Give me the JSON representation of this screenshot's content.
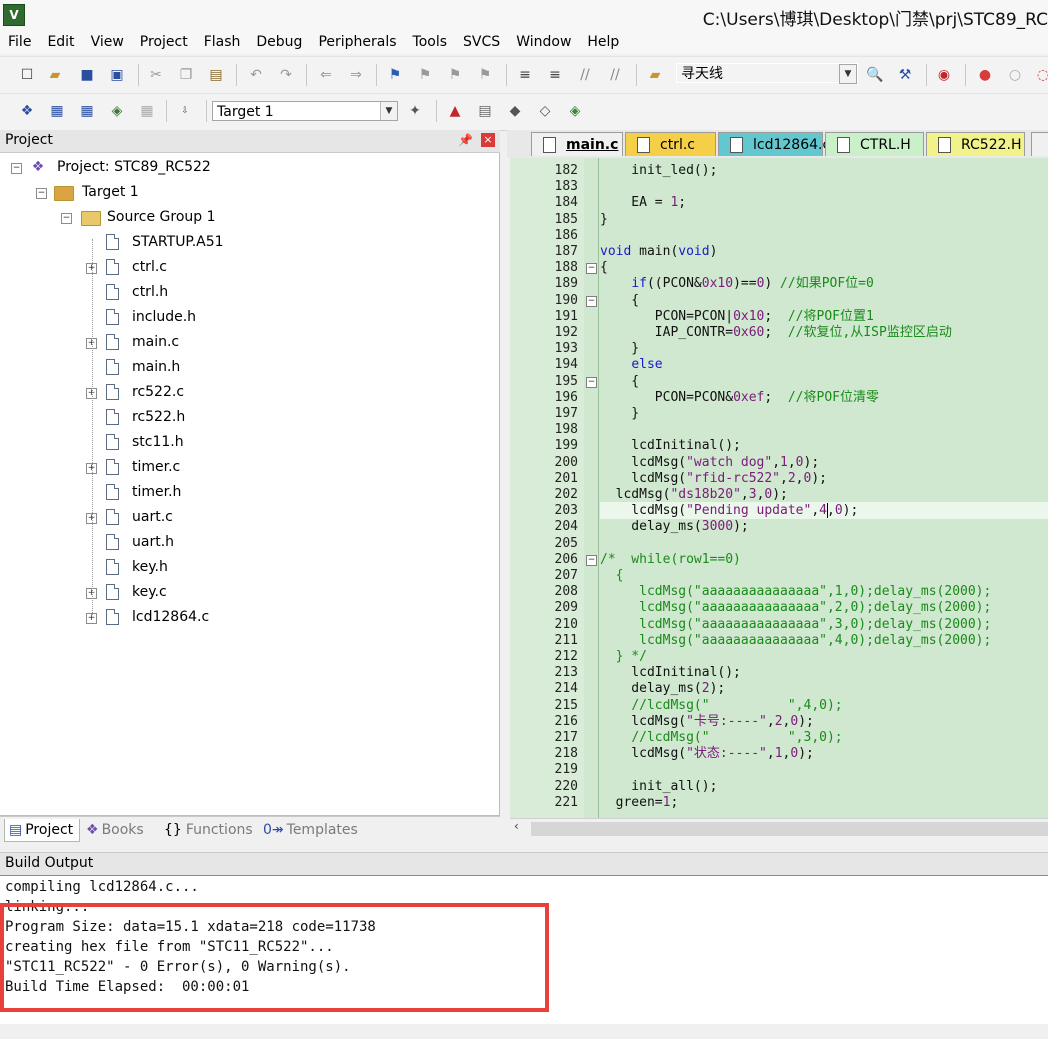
{
  "window": {
    "icon_text": "V",
    "title": "C:\\Users\\博琪\\Desktop\\门禁\\prj\\STC89_RC"
  },
  "menu": [
    "File",
    "Edit",
    "View",
    "Project",
    "Flash",
    "Debug",
    "Peripherals",
    "Tools",
    "SVCS",
    "Window",
    "Help"
  ],
  "toolbar1": {
    "search_value": "寻天线"
  },
  "toolbar2": {
    "target_value": "Target 1"
  },
  "project_panel": {
    "title": "Project",
    "tree": [
      {
        "label": "Project: STC89_RC522",
        "level": 0,
        "kind": "project",
        "expander": "−"
      },
      {
        "label": "Target 1",
        "level": 1,
        "kind": "target",
        "expander": "−"
      },
      {
        "label": "Source Group 1",
        "level": 2,
        "kind": "folder",
        "expander": "−"
      },
      {
        "label": "STARTUP.A51",
        "level": 3,
        "kind": "file",
        "expander": ""
      },
      {
        "label": "ctrl.c",
        "level": 3,
        "kind": "file",
        "expander": "+"
      },
      {
        "label": "ctrl.h",
        "level": 3,
        "kind": "file",
        "expander": ""
      },
      {
        "label": "include.h",
        "level": 3,
        "kind": "file",
        "expander": ""
      },
      {
        "label": "main.c",
        "level": 3,
        "kind": "file",
        "expander": "+"
      },
      {
        "label": "main.h",
        "level": 3,
        "kind": "file",
        "expander": ""
      },
      {
        "label": "rc522.c",
        "level": 3,
        "kind": "file",
        "expander": "+"
      },
      {
        "label": "rc522.h",
        "level": 3,
        "kind": "file",
        "expander": ""
      },
      {
        "label": "stc11.h",
        "level": 3,
        "kind": "file",
        "expander": ""
      },
      {
        "label": "timer.c",
        "level": 3,
        "kind": "file",
        "expander": "+"
      },
      {
        "label": "timer.h",
        "level": 3,
        "kind": "file",
        "expander": ""
      },
      {
        "label": "uart.c",
        "level": 3,
        "kind": "file",
        "expander": "+"
      },
      {
        "label": "uart.h",
        "level": 3,
        "kind": "file",
        "expander": ""
      },
      {
        "label": "key.h",
        "level": 3,
        "kind": "file",
        "expander": ""
      },
      {
        "label": "key.c",
        "level": 3,
        "kind": "file",
        "expander": "+"
      },
      {
        "label": "lcd12864.c",
        "level": 3,
        "kind": "file",
        "expander": "+"
      }
    ],
    "tabs": [
      {
        "label": "Project",
        "icon": "▤",
        "active": true
      },
      {
        "label": "Books",
        "icon": "❖",
        "active": false
      },
      {
        "label": "Functions",
        "icon": "{}",
        "active": false
      },
      {
        "label": "Templates",
        "icon": "0↠",
        "active": false
      }
    ]
  },
  "editor_tabs": [
    {
      "label": "main.c",
      "color": "#f0f0f0",
      "bold": true
    },
    {
      "label": "ctrl.c",
      "color": "#f6cf48",
      "bold": false
    },
    {
      "label": "lcd12864.c",
      "color": "#62c7cf",
      "bold": false
    },
    {
      "label": "CTRL.H",
      "color": "#c9f0c9",
      "bold": false
    },
    {
      "label": "RC522.H",
      "color": "#f2f28a",
      "bold": false
    }
  ],
  "code_lines": [
    {
      "n": "182",
      "fold": "",
      "segs": [
        [
          "",
          "    init_led();"
        ]
      ]
    },
    {
      "n": "183",
      "fold": "",
      "segs": [
        [
          "",
          ""
        ]
      ]
    },
    {
      "n": "184",
      "fold": "",
      "segs": [
        [
          "",
          "    EA = "
        ],
        [
          "num",
          "1"
        ],
        [
          "",
          ";"
        ]
      ]
    },
    {
      "n": "185",
      "fold": "",
      "segs": [
        [
          "",
          "}"
        ]
      ]
    },
    {
      "n": "186",
      "fold": "",
      "segs": [
        [
          "",
          ""
        ]
      ]
    },
    {
      "n": "187",
      "fold": "",
      "segs": [
        [
          "kw",
          "void"
        ],
        [
          "",
          " main("
        ],
        [
          "kw",
          "void"
        ],
        [
          "",
          ")"
        ]
      ]
    },
    {
      "n": "188",
      "fold": "−",
      "segs": [
        [
          "",
          "{"
        ]
      ]
    },
    {
      "n": "189",
      "fold": "",
      "segs": [
        [
          "",
          "    "
        ],
        [
          "kw",
          "if"
        ],
        [
          "",
          "((PCON&"
        ],
        [
          "num",
          "0x10"
        ],
        [
          "",
          ")=="
        ],
        [
          "num",
          "0"
        ],
        [
          "",
          ") "
        ],
        [
          "cm",
          "//如果POF位=0"
        ]
      ]
    },
    {
      "n": "190",
      "fold": "−",
      "segs": [
        [
          "",
          "    {"
        ]
      ]
    },
    {
      "n": "191",
      "fold": "",
      "segs": [
        [
          "",
          "       PCON=PCON|"
        ],
        [
          "num",
          "0x10"
        ],
        [
          "",
          ";  "
        ],
        [
          "cm",
          "//将POF位置1"
        ]
      ]
    },
    {
      "n": "192",
      "fold": "",
      "segs": [
        [
          "",
          "       IAP_CONTR="
        ],
        [
          "num",
          "0x60"
        ],
        [
          "",
          ";  "
        ],
        [
          "cm",
          "//软复位,从ISP监控区启动"
        ]
      ]
    },
    {
      "n": "193",
      "fold": "",
      "segs": [
        [
          "",
          "    }"
        ]
      ]
    },
    {
      "n": "194",
      "fold": "",
      "segs": [
        [
          "",
          "    "
        ],
        [
          "kw",
          "else"
        ]
      ]
    },
    {
      "n": "195",
      "fold": "−",
      "segs": [
        [
          "",
          "    {"
        ]
      ]
    },
    {
      "n": "196",
      "fold": "",
      "segs": [
        [
          "",
          "       PCON=PCON&"
        ],
        [
          "num",
          "0xef"
        ],
        [
          "",
          ";  "
        ],
        [
          "cm",
          "//将POF位清零"
        ]
      ]
    },
    {
      "n": "197",
      "fold": "",
      "segs": [
        [
          "",
          "    }"
        ]
      ]
    },
    {
      "n": "198",
      "fold": "",
      "segs": [
        [
          "",
          ""
        ]
      ]
    },
    {
      "n": "199",
      "fold": "",
      "segs": [
        [
          "",
          "    lcdInitinal();"
        ]
      ]
    },
    {
      "n": "200",
      "fold": "",
      "segs": [
        [
          "",
          "    lcdMsg("
        ],
        [
          "str",
          "\"watch dog\""
        ],
        [
          "",
          ","
        ],
        [
          "num",
          "1"
        ],
        [
          "",
          ","
        ],
        [
          "num",
          "0"
        ],
        [
          "",
          ");"
        ]
      ]
    },
    {
      "n": "201",
      "fold": "",
      "segs": [
        [
          "",
          "    lcdMsg("
        ],
        [
          "str",
          "\"rfid-rc522\""
        ],
        [
          "",
          ","
        ],
        [
          "num",
          "2"
        ],
        [
          "",
          ","
        ],
        [
          "num",
          "0"
        ],
        [
          "",
          ");"
        ]
      ]
    },
    {
      "n": "202",
      "fold": "",
      "segs": [
        [
          "",
          "  lcdMsg("
        ],
        [
          "str",
          "\"ds18b20\""
        ],
        [
          "",
          ","
        ],
        [
          "num",
          "3"
        ],
        [
          "",
          ","
        ],
        [
          "num",
          "0"
        ],
        [
          "",
          ");"
        ]
      ]
    },
    {
      "n": "203",
      "fold": "",
      "segs": [
        [
          "",
          "    lcdMsg("
        ],
        [
          "str",
          "\"Pending update\""
        ],
        [
          "",
          ","
        ],
        [
          "num",
          "4"
        ],
        [
          "",
          ","
        ],
        [
          "num",
          "0"
        ],
        [
          "",
          ");"
        ]
      ]
    },
    {
      "n": "204",
      "fold": "",
      "segs": [
        [
          "",
          "    delay_ms("
        ],
        [
          "num",
          "3000"
        ],
        [
          "",
          ");"
        ]
      ]
    },
    {
      "n": "205",
      "fold": "",
      "segs": [
        [
          "",
          ""
        ]
      ]
    },
    {
      "n": "206",
      "fold": "−",
      "segs": [
        [
          "cm",
          "/*  while(row1==0)"
        ]
      ]
    },
    {
      "n": "207",
      "fold": "",
      "segs": [
        [
          "cm",
          "  {"
        ]
      ]
    },
    {
      "n": "208",
      "fold": "",
      "segs": [
        [
          "cm",
          "     lcdMsg(\"aaaaaaaaaaaaaaa\",1,0);delay_ms(2000);"
        ]
      ]
    },
    {
      "n": "209",
      "fold": "",
      "segs": [
        [
          "cm",
          "     lcdMsg(\"aaaaaaaaaaaaaaa\",2,0);delay_ms(2000);"
        ]
      ]
    },
    {
      "n": "210",
      "fold": "",
      "segs": [
        [
          "cm",
          "     lcdMsg(\"aaaaaaaaaaaaaaa\",3,0);delay_ms(2000);"
        ]
      ]
    },
    {
      "n": "211",
      "fold": "",
      "segs": [
        [
          "cm",
          "     lcdMsg(\"aaaaaaaaaaaaaaa\",4,0);delay_ms(2000);"
        ]
      ]
    },
    {
      "n": "212",
      "fold": "",
      "segs": [
        [
          "cm",
          "  } */"
        ]
      ]
    },
    {
      "n": "213",
      "fold": "",
      "segs": [
        [
          "",
          "    lcdInitinal();"
        ]
      ]
    },
    {
      "n": "214",
      "fold": "",
      "segs": [
        [
          "",
          "    delay_ms("
        ],
        [
          "num",
          "2"
        ],
        [
          "",
          ");"
        ]
      ]
    },
    {
      "n": "215",
      "fold": "",
      "segs": [
        [
          "",
          "    "
        ],
        [
          "cm",
          "//lcdMsg(\"          \",4,0);"
        ]
      ]
    },
    {
      "n": "216",
      "fold": "",
      "segs": [
        [
          "",
          "    lcdMsg("
        ],
        [
          "str",
          "\"卡号:----\""
        ],
        [
          "",
          ","
        ],
        [
          "num",
          "2"
        ],
        [
          "",
          ","
        ],
        [
          "num",
          "0"
        ],
        [
          "",
          ");"
        ]
      ]
    },
    {
      "n": "217",
      "fold": "",
      "segs": [
        [
          "",
          "    "
        ],
        [
          "cm",
          "//lcdMsg(\"          \",3,0);"
        ]
      ]
    },
    {
      "n": "218",
      "fold": "",
      "segs": [
        [
          "",
          "    lcdMsg("
        ],
        [
          "str",
          "\"状态:----\""
        ],
        [
          "",
          ","
        ],
        [
          "num",
          "1"
        ],
        [
          "",
          ","
        ],
        [
          "num",
          "0"
        ],
        [
          "",
          ");"
        ]
      ]
    },
    {
      "n": "219",
      "fold": "",
      "segs": [
        [
          "",
          ""
        ]
      ]
    },
    {
      "n": "220",
      "fold": "",
      "segs": [
        [
          "",
          "    init_all();"
        ]
      ]
    },
    {
      "n": "221",
      "fold": "",
      "segs": [
        [
          "",
          "  green="
        ],
        [
          "num",
          "1"
        ],
        [
          "",
          ";"
        ]
      ]
    }
  ],
  "build_output": {
    "title": "Build Output",
    "lines": [
      "compiling lcd12864.c...",
      "linking...",
      "Program Size: data=15.1 xdata=218 code=11738",
      "creating hex file from \"STC11_RC522\"...",
      "\"STC11_RC522\" - 0 Error(s), 0 Warning(s).",
      "Build Time Elapsed:  00:00:01"
    ]
  },
  "colors": {
    "editor_bg": "#cfe8cf",
    "highlight_box": "#e8403c",
    "keyword": "#1a1acc",
    "comment": "#1a8a1a",
    "number": "#7a1a7a"
  }
}
